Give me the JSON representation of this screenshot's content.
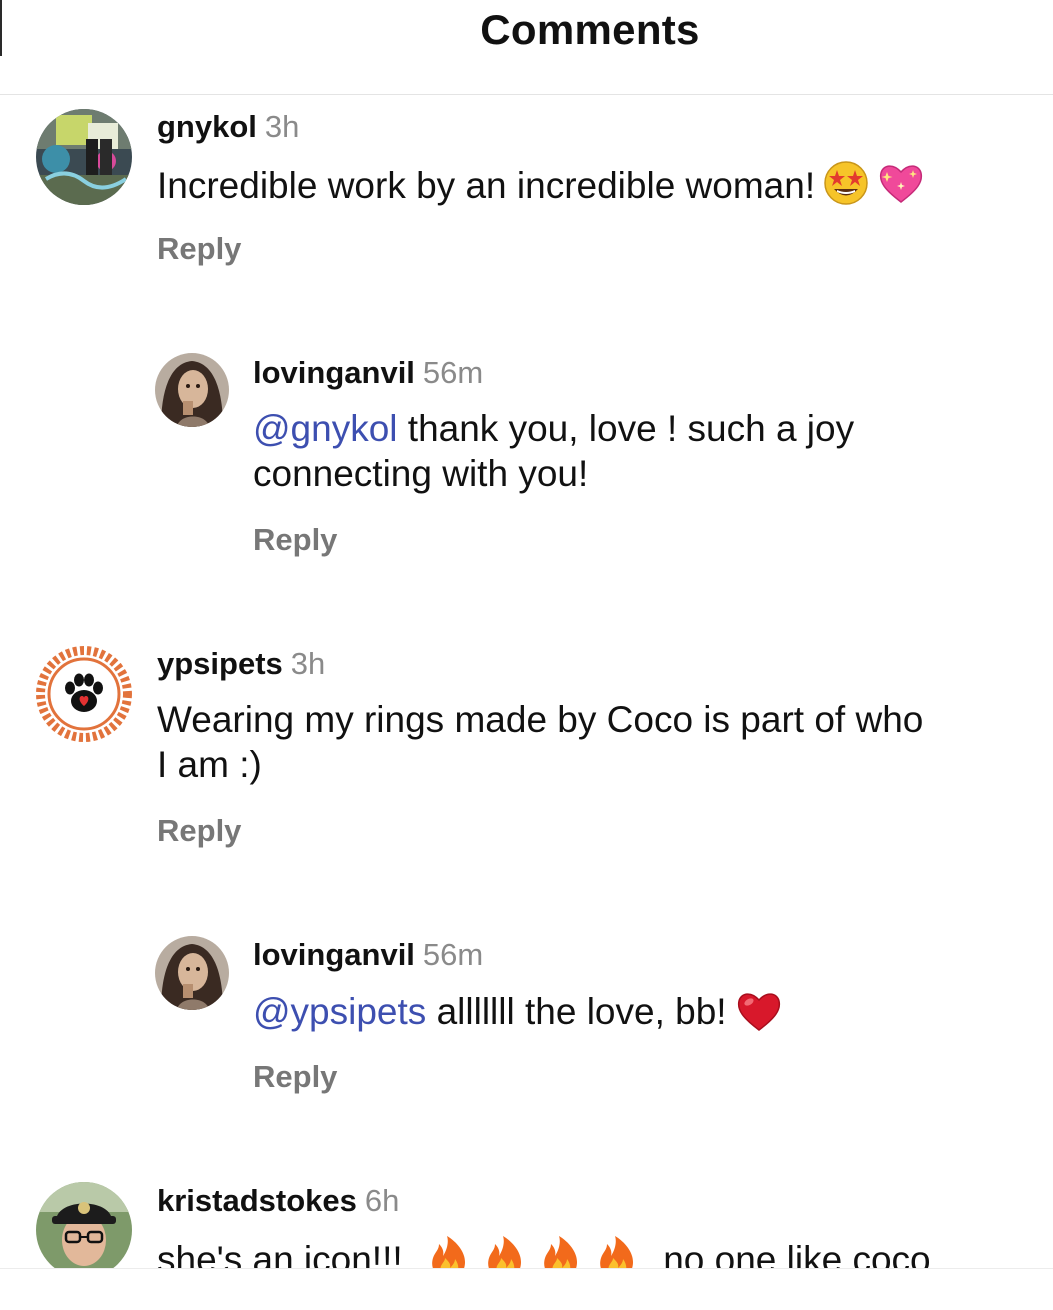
{
  "header": {
    "title": "Comments"
  },
  "comments": [
    {
      "username": "gnykol",
      "time": "3h",
      "text": "Incredible work by an incredible woman!",
      "reply_label": "Reply"
    },
    {
      "username": "lovinganvil",
      "time": "56m",
      "mention": "@gnykol",
      "text_line1": " thank you, love ! such a joy",
      "text_line2": "connecting with you!",
      "reply_label": "Reply"
    },
    {
      "username": "ypsipets",
      "time": "3h",
      "text_line1": "Wearing my rings made by Coco is part of who",
      "text_line2": "I am :)",
      "reply_label": "Reply"
    },
    {
      "username": "lovinganvil",
      "time": "56m",
      "mention": "@ypsipets",
      "text": " alllllll the love, bb!",
      "reply_label": "Reply"
    },
    {
      "username": "kristadstokes",
      "time": "6h",
      "text_a": "she's an icon!!!",
      "text_b": "no one like coco."
    }
  ],
  "colors": {
    "mention": "#3d4fb0",
    "secondary_text": "#8a8a8a",
    "reply": "#777777"
  }
}
